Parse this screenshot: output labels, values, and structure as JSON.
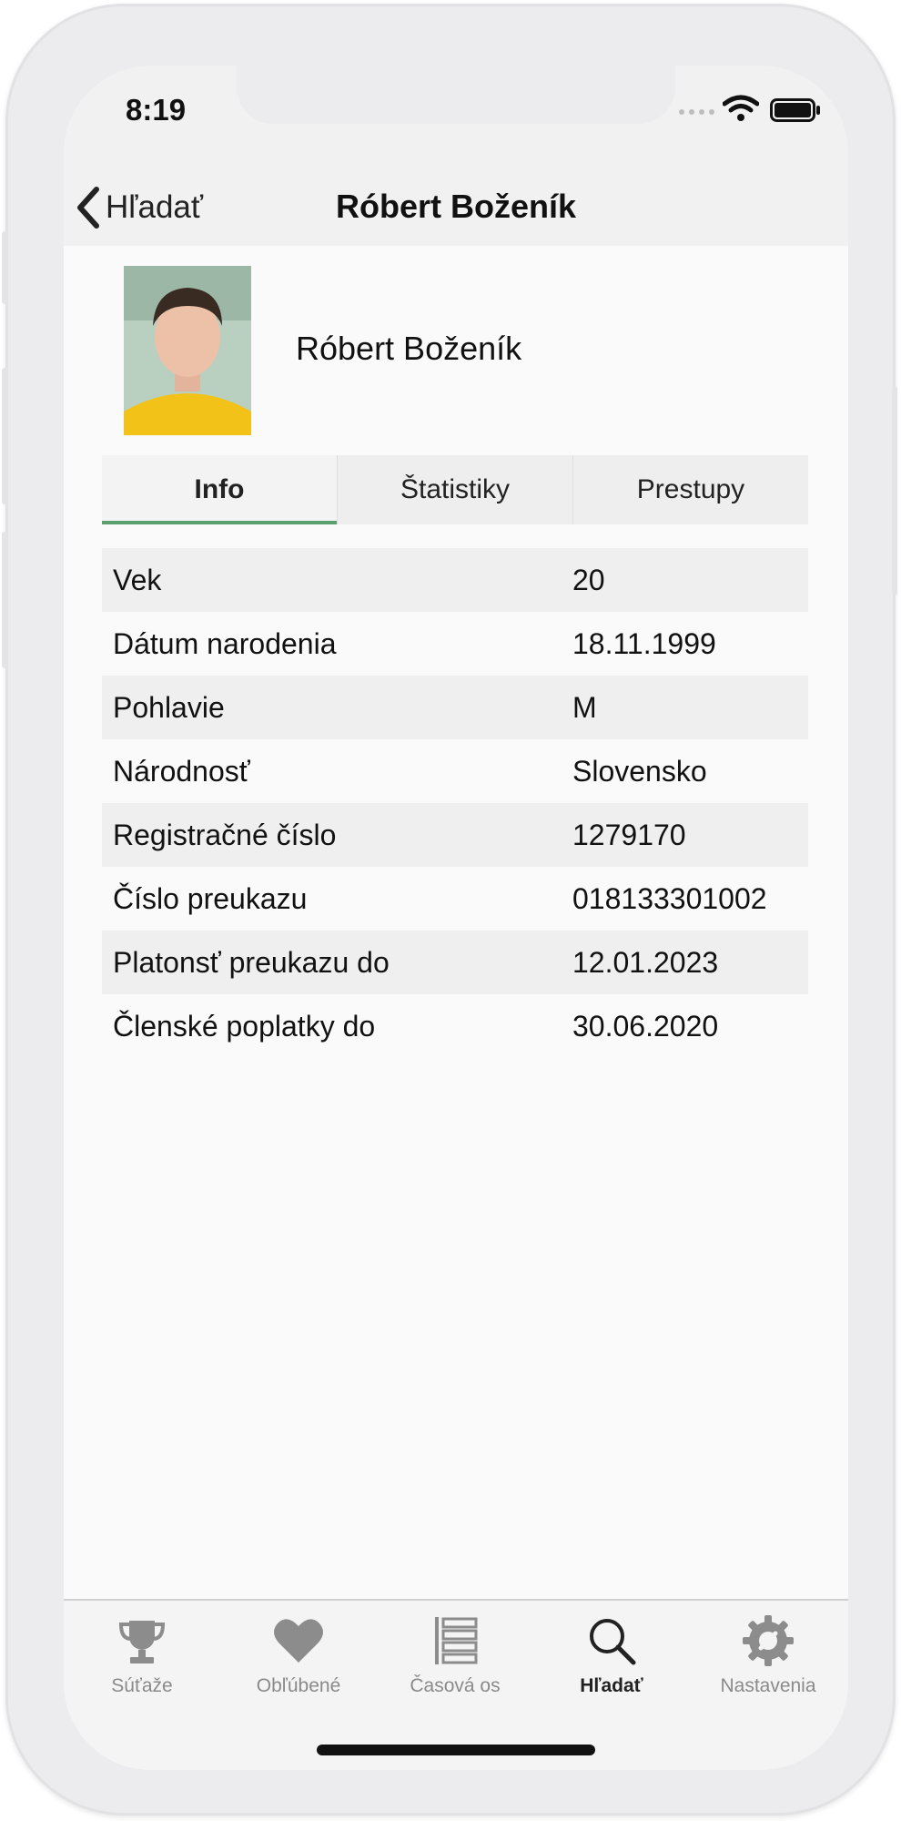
{
  "status_bar": {
    "time": "8:19"
  },
  "nav": {
    "back_label": "Hľadať",
    "title": "Róbert Boženík"
  },
  "profile": {
    "name": "Róbert Boženík"
  },
  "tabs": [
    {
      "label": "Info",
      "active": true
    },
    {
      "label": "Štatistiky",
      "active": false
    },
    {
      "label": "Prestupy",
      "active": false
    }
  ],
  "info_rows": [
    {
      "label": "Vek",
      "value": "20"
    },
    {
      "label": "Dátum narodenia",
      "value": "18.11.1999"
    },
    {
      "label": "Pohlavie",
      "value": "M"
    },
    {
      "label": "Národnosť",
      "value": "Slovensko"
    },
    {
      "label": "Registračné číslo",
      "value": "1279170"
    },
    {
      "label": "Číslo preukazu",
      "value": "018133301002"
    },
    {
      "label": "Platonsť preukazu do",
      "value": "12.01.2023"
    },
    {
      "label": "Členské poplatky do",
      "value": "30.06.2020"
    }
  ],
  "tab_bar": [
    {
      "label": "Súťaže",
      "icon": "trophy-icon",
      "active": false
    },
    {
      "label": "Obľúbené",
      "icon": "heart-icon",
      "active": false
    },
    {
      "label": "Časová os",
      "icon": "timeline-icon",
      "active": false
    },
    {
      "label": "Hľadať",
      "icon": "search-icon",
      "active": true
    },
    {
      "label": "Nastavenia",
      "icon": "settings-gear-icon",
      "active": false
    }
  ],
  "colors": {
    "tab_active_underline": "#5aa06e",
    "tab_bar_active": "#222222",
    "tab_bar_inactive": "#8a8a8a"
  }
}
